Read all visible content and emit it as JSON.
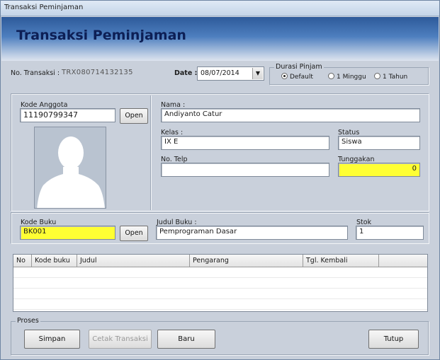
{
  "window": {
    "title": "Transaksi Peminjaman"
  },
  "banner": {
    "heading": "Transaksi Peminjaman"
  },
  "transaction": {
    "no_label": "No. Transaksi :",
    "no_value": "TRX080714132135",
    "date_label": "Date :",
    "date_value": "08/07/2014"
  },
  "durasi": {
    "legend": "Durasi Pinjam",
    "options": [
      {
        "label": "Default",
        "selected": true
      },
      {
        "label": "1 Minggu",
        "selected": false
      },
      {
        "label": "1 Tahun",
        "selected": false
      }
    ]
  },
  "anggota": {
    "kode_label": "Kode Anggota",
    "kode_value": "11190799347",
    "open_label": "Open",
    "photo_icon": "user-silhouette-icon",
    "nama_label": "Nama :",
    "nama_value": "Andiyanto Catur",
    "kelas_label": "Kelas :",
    "kelas_value": "IX E",
    "status_label": "Status",
    "status_value": "Siswa",
    "telp_label": "No. Telp",
    "telp_value": "",
    "tunggakan_label": "Tunggakan",
    "tunggakan_value": "0"
  },
  "buku": {
    "kode_label": "Kode Buku",
    "kode_value": "BK001",
    "open_label": "Open",
    "judul_label": "Judul Buku :",
    "judul_value": "Pemprograman Dasar",
    "stok_label": "Stok",
    "stok_value": "1"
  },
  "table": {
    "columns": [
      "No",
      "Kode buku",
      "Judul",
      "Pengarang",
      "Tgl. Kembali",
      ""
    ]
  },
  "proses": {
    "legend": "Proses",
    "simpan": "Simpan",
    "cetak": "Cetak Transaksi",
    "baru": "Baru",
    "tutup": "Tutup"
  },
  "colors": {
    "highlight_field": "#ffff33",
    "heading": "#0d1f55",
    "banner_top": "#2d5a9a"
  }
}
